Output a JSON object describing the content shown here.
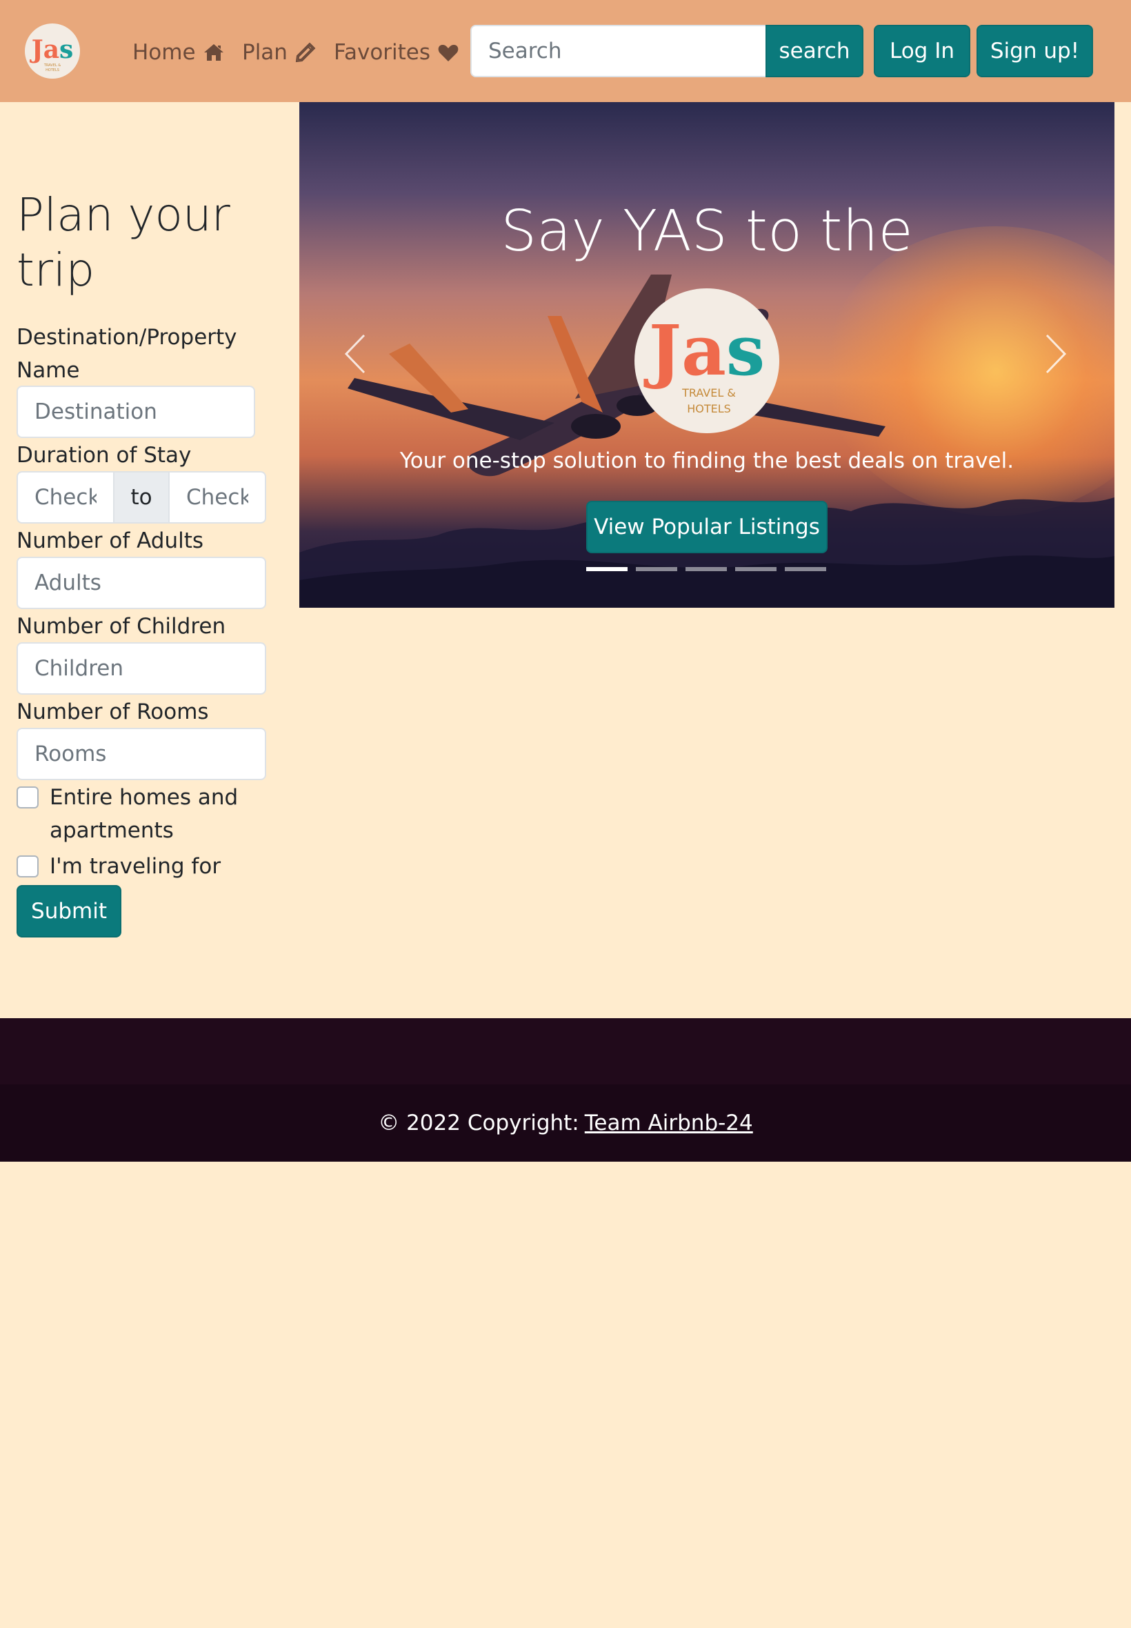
{
  "brand": {
    "logo_text": "Jas",
    "logo_subtext": "TRAVEL & HOTELS",
    "colors": {
      "navbar": "#e8a87c",
      "accent": "#0b7a7c",
      "background": "#ffecce",
      "footer": "#1a0716"
    }
  },
  "nav": {
    "items": [
      {
        "label": "Home",
        "icon": "home-icon"
      },
      {
        "label": "Plan",
        "icon": "pencil-icon"
      },
      {
        "label": "Favorites",
        "icon": "heart-icon"
      }
    ],
    "search_placeholder": "Search",
    "search_button": "search",
    "login_button": "Log In",
    "signup_button": "Sign up!"
  },
  "form": {
    "title": "Plan your trip",
    "destination_label": "Destination/Property Name",
    "destination_placeholder": "Destination",
    "duration_label": "Duration of Stay",
    "checkin_placeholder": "Check-in",
    "to_label": "to",
    "checkout_placeholder": "Check-out",
    "adults_label": "Number of Adults",
    "adults_placeholder": "Adults",
    "children_label": "Number of Children",
    "children_placeholder": "Children",
    "rooms_label": "Number of Rooms",
    "rooms_placeholder": "Rooms",
    "checkbox_homes": "Entire homes and apartments",
    "checkbox_work": "I'm traveling for work",
    "submit_button": "Submit"
  },
  "carousel": {
    "title": "Say YAS to the",
    "logo_text": "Jas",
    "logo_subtext": "TRAVEL & HOTELS",
    "subtitle": "Your one-stop solution to finding the best deals on travel.",
    "button": "View Popular Listings",
    "slide_count": 5,
    "active_slide": 1
  },
  "footer": {
    "copyright": "© 2022 Copyright:",
    "link": "Team Airbnb-24"
  }
}
